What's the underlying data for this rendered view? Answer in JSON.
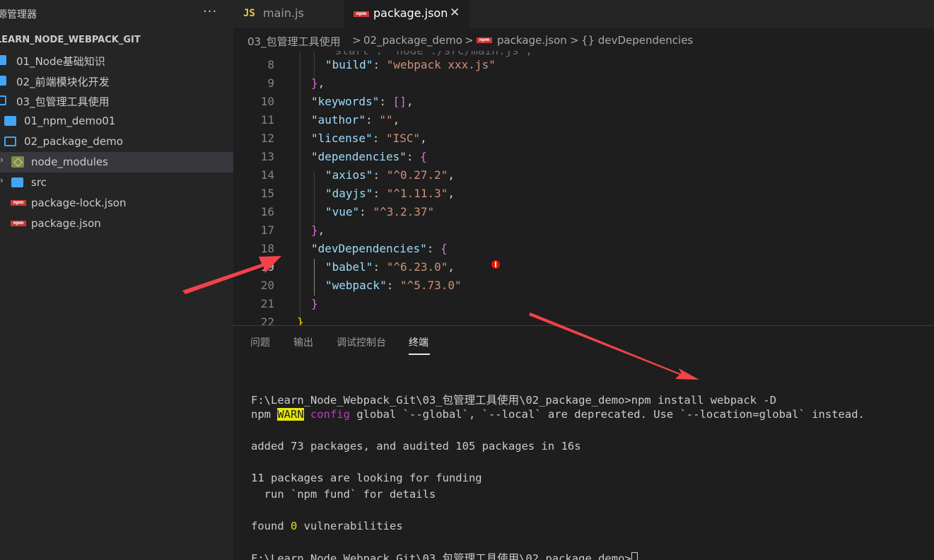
{
  "sidebar": {
    "title": "源管理器",
    "more_label": "···",
    "root": "LEARN_NODE_WEBPACK_GIT",
    "items": [
      {
        "label": "01_Node基础知识",
        "icon": "folder-icon"
      },
      {
        "label": "02_前端模块化开发",
        "icon": "folder-icon"
      },
      {
        "label": "03_包管理工具使用",
        "icon": "folder-open-icon"
      },
      {
        "label": "01_npm_demo01",
        "icon": "folder-icon"
      },
      {
        "label": "02_package_demo",
        "icon": "folder-open-icon"
      },
      {
        "label": "node_modules",
        "icon": "node-modules-icon"
      },
      {
        "label": "src",
        "icon": "folder-icon"
      },
      {
        "label": "package-lock.json",
        "icon": "npm-file-icon"
      },
      {
        "label": "package.json",
        "icon": "npm-file-icon"
      }
    ]
  },
  "tabs": [
    {
      "label": "main.js",
      "icon": "JS",
      "active": false
    },
    {
      "label": "package.json",
      "icon": "npm",
      "active": true,
      "close": "✕"
    }
  ],
  "breadcrumb": {
    "parts": [
      "03_包管理工具使用",
      ">",
      "02_package_demo",
      ">",
      "package.json",
      ">",
      "{} devDependencies"
    ]
  },
  "editor": {
    "lines": [
      {
        "n": "8",
        "indent": 2,
        "tokens": [
          [
            "k",
            "\"build\""
          ],
          [
            "p",
            ": "
          ],
          [
            "s",
            "\"webpack xxx.js\""
          ]
        ]
      },
      {
        "n": "9",
        "indent": 1,
        "tokens": [
          [
            "b",
            "}"
          ],
          [
            "p",
            ","
          ]
        ]
      },
      {
        "n": "10",
        "indent": 1,
        "tokens": [
          [
            "k",
            "\"keywords\""
          ],
          [
            "p",
            ": "
          ],
          [
            "b",
            "[]"
          ],
          [
            "p",
            ","
          ]
        ]
      },
      {
        "n": "11",
        "indent": 1,
        "tokens": [
          [
            "k",
            "\"author\""
          ],
          [
            "p",
            ": "
          ],
          [
            "s",
            "\"\""
          ],
          [
            "p",
            ","
          ]
        ]
      },
      {
        "n": "12",
        "indent": 1,
        "tokens": [
          [
            "k",
            "\"license\""
          ],
          [
            "p",
            ": "
          ],
          [
            "s",
            "\"ISC\""
          ],
          [
            "p",
            ","
          ]
        ]
      },
      {
        "n": "13",
        "indent": 1,
        "tokens": [
          [
            "k",
            "\"dependencies\""
          ],
          [
            "p",
            ": "
          ],
          [
            "b",
            "{"
          ]
        ]
      },
      {
        "n": "14",
        "indent": 2,
        "tokens": [
          [
            "k",
            "\"axios\""
          ],
          [
            "p",
            ": "
          ],
          [
            "s",
            "\"^0.27.2\""
          ],
          [
            "p",
            ","
          ]
        ]
      },
      {
        "n": "15",
        "indent": 2,
        "tokens": [
          [
            "k",
            "\"dayjs\""
          ],
          [
            "p",
            ": "
          ],
          [
            "s",
            "\"^1.11.3\""
          ],
          [
            "p",
            ","
          ]
        ]
      },
      {
        "n": "16",
        "indent": 2,
        "tokens": [
          [
            "k",
            "\"vue\""
          ],
          [
            "p",
            ": "
          ],
          [
            "s",
            "\"^3.2.37\""
          ]
        ]
      },
      {
        "n": "17",
        "indent": 1,
        "tokens": [
          [
            "b",
            "}"
          ],
          [
            "p",
            ","
          ]
        ]
      },
      {
        "n": "18",
        "indent": 1,
        "tokens": [
          [
            "k",
            "\"devDependencies\""
          ],
          [
            "p",
            ": "
          ],
          [
            "b",
            "{"
          ]
        ]
      },
      {
        "n": "19",
        "indent": 2,
        "tokens": [
          [
            "k",
            "\"babel\""
          ],
          [
            "p",
            ": "
          ],
          [
            "s",
            "\"^6.23.0\""
          ],
          [
            "p",
            ","
          ]
        ]
      },
      {
        "n": "20",
        "indent": 2,
        "tokens": [
          [
            "k",
            "\"webpack\""
          ],
          [
            "p",
            ": "
          ],
          [
            "s",
            "\"^5.73.0\""
          ]
        ]
      },
      {
        "n": "21",
        "indent": 1,
        "tokens": [
          [
            "b",
            "}"
          ]
        ]
      },
      {
        "n": "22",
        "indent": 0,
        "tokens": [
          [
            "y",
            "}"
          ]
        ]
      }
    ],
    "current_line": "19"
  },
  "panel": {
    "tabs": [
      "问题",
      "输出",
      "调试控制台",
      "终端"
    ],
    "active_tab": "终端",
    "terminal": {
      "l1": "F:\\Learn_Node_Webpack_Git\\03_包管理工具使用\\02_package_demo>npm install webpack -D",
      "l2_a": "npm ",
      "l2_warn": "WARN",
      "l2_b": " ",
      "l2_cfg": "config",
      "l2_c": " global `--global`, `--local` are deprecated. Use `--location=global` instead.",
      "l3": "added 73 packages, and audited 105 packages in 16s",
      "l4": "11 packages are looking for funding",
      "l5": "  run `npm fund` for details",
      "l6_a": "found ",
      "l6_num": "0",
      "l6_b": " vulnerabilities",
      "l7": "F:\\Learn_Node_Webpack_Git\\03_包管理工具使用\\02_package_demo>"
    }
  },
  "colors": {
    "annotation_arrow": "#f2424a"
  }
}
